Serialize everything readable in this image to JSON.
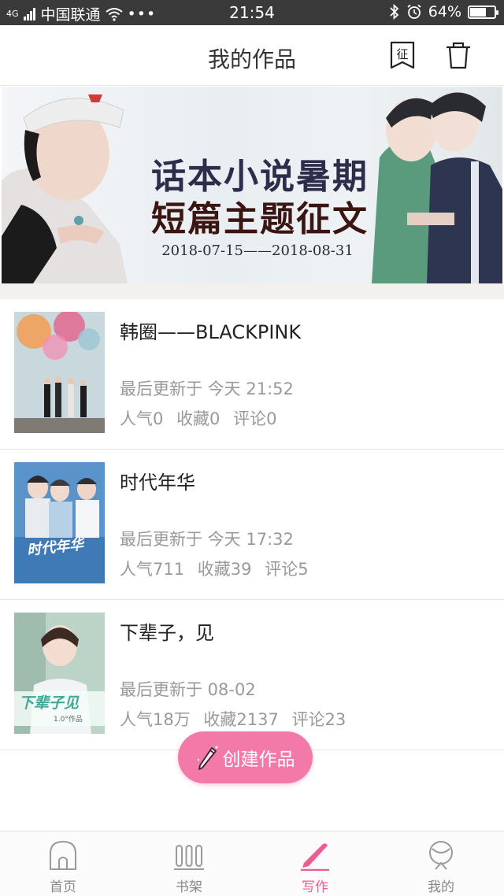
{
  "status_bar": {
    "carrier": "中国联通",
    "network": "4G",
    "time": "21:54",
    "battery": "64%",
    "battery_level": 0.64
  },
  "header": {
    "title": "我的作品",
    "contest_icon_char": "征"
  },
  "banner": {
    "title_line1": "话本小说暑期",
    "title_line2": "短篇主题征文",
    "dates": "2018-07-15——2018-08-31"
  },
  "works": [
    {
      "title": "韩圈——BLACKPINK",
      "updated": "最后更新于 今天 21:52",
      "popularity": "人气0",
      "favorites": "收藏0",
      "comments": "评论0"
    },
    {
      "title": "时代年华",
      "updated": "最后更新于 今天 17:32",
      "popularity": "人气711",
      "favorites": "收藏39",
      "comments": "评论5",
      "cover_text": "时代年华"
    },
    {
      "title": "下辈子，见",
      "updated": "最后更新于 08-02",
      "popularity": "人气18万",
      "favorites": "收藏2137",
      "comments": "评论23",
      "cover_text": "下辈子见",
      "cover_subtext": "1.0°作品"
    }
  ],
  "create_button": {
    "label": "创建作品"
  },
  "bottom_nav": [
    {
      "label": "首页",
      "icon": "home-icon"
    },
    {
      "label": "书架",
      "icon": "bookshelf-icon"
    },
    {
      "label": "写作",
      "icon": "pencil-icon",
      "active": true
    },
    {
      "label": "我的",
      "icon": "profile-icon"
    }
  ],
  "colors": {
    "accent": "#f37aa8",
    "active_nav": "#ee5c95",
    "status_bar_bg": "#3a3a3a",
    "meta_text": "#999999"
  }
}
